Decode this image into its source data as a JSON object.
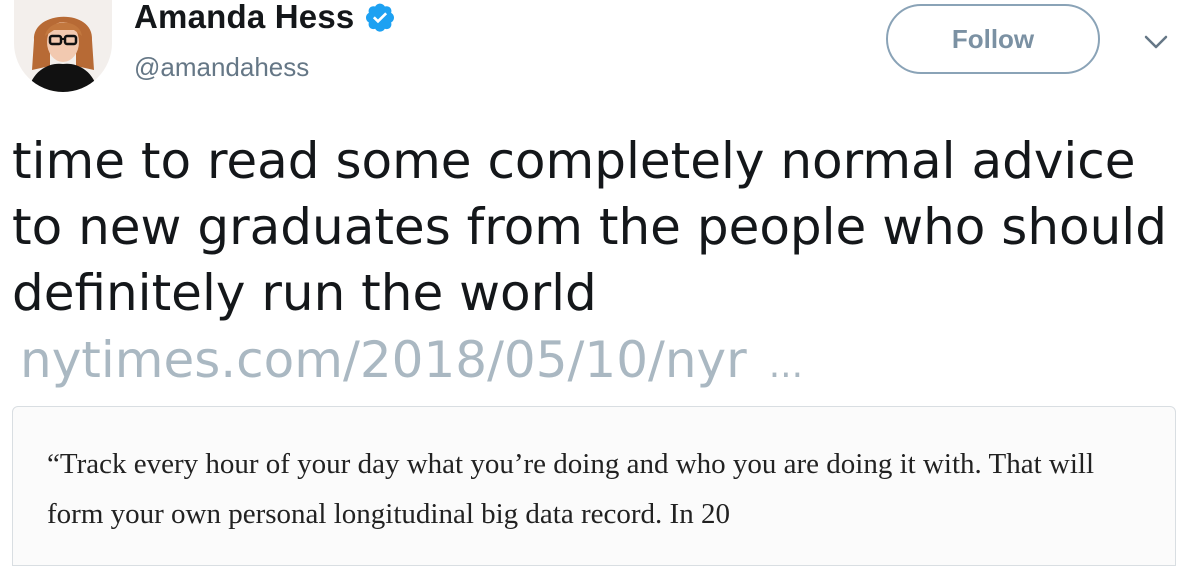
{
  "author": {
    "display_name": "Amanda Hess",
    "handle": "@amandahess",
    "verified": true
  },
  "header": {
    "follow_label": "Follow",
    "menu_icon": "chevron-down-icon"
  },
  "tweet": {
    "text": "time to read some completely normal advice to new graduates from the people who should definitely run the world",
    "link_text": "nytimes.com/2018/05/10/nyr",
    "link_ellipsis": "..."
  },
  "card": {
    "quote": "“Track every hour of your day what you’re doing and who you are doing it with. That will form your own personal longitudinal big data record. In 20"
  },
  "colors": {
    "verified_badge": "#1da1f2",
    "link": "#aab8c2",
    "handle": "#657786",
    "follow_border": "#8aa3b7"
  }
}
